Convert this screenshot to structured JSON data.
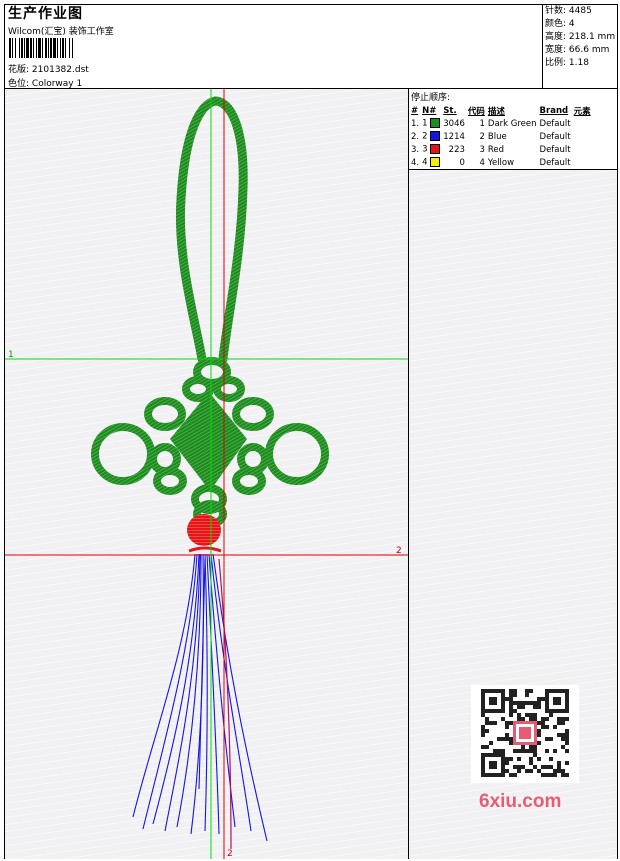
{
  "header": {
    "title": "生产作业图",
    "company": "Wilcom(汇宝) 装饰工作室",
    "design_label": "花版:",
    "design_value": "2101382.dst",
    "colorway_label": "色位:",
    "colorway_value": "Colorway 1"
  },
  "specs": {
    "stitches_label": "针数:",
    "stitches_value": "4485",
    "colors_label": "颜色:",
    "colors_value": "4",
    "height_label": "高度:",
    "height_value": "218.1 mm",
    "width_label": "宽度:",
    "width_value": "66.6 mm",
    "scale_label": "比例:",
    "scale_value": "1.18"
  },
  "stop_sequence": {
    "title": "停止顺序:",
    "columns": [
      "#",
      "N#",
      "St.",
      "代码",
      "描述",
      "Brand",
      "元素"
    ],
    "rows": [
      {
        "index": "1.",
        "needle": "1",
        "color": "#1e8c1e",
        "stitches": "3046",
        "code": "1",
        "description": "Dark Green",
        "brand": "Default"
      },
      {
        "index": "2.",
        "needle": "2",
        "color": "#1414e6",
        "stitches": "1214",
        "code": "2",
        "description": "Blue",
        "brand": "Default"
      },
      {
        "index": "3.",
        "needle": "3",
        "color": "#e61414",
        "stitches": "223",
        "code": "3",
        "description": "Red",
        "brand": "Default"
      },
      {
        "index": "4.",
        "needle": "4",
        "color": "#f0f000",
        "stitches": "0",
        "code": "4",
        "description": "Yellow",
        "brand": "Default"
      }
    ]
  },
  "guides": {
    "h1_label": "1",
    "h2_label": "2",
    "v2_label": "2"
  },
  "watermark": "6xiu.com"
}
